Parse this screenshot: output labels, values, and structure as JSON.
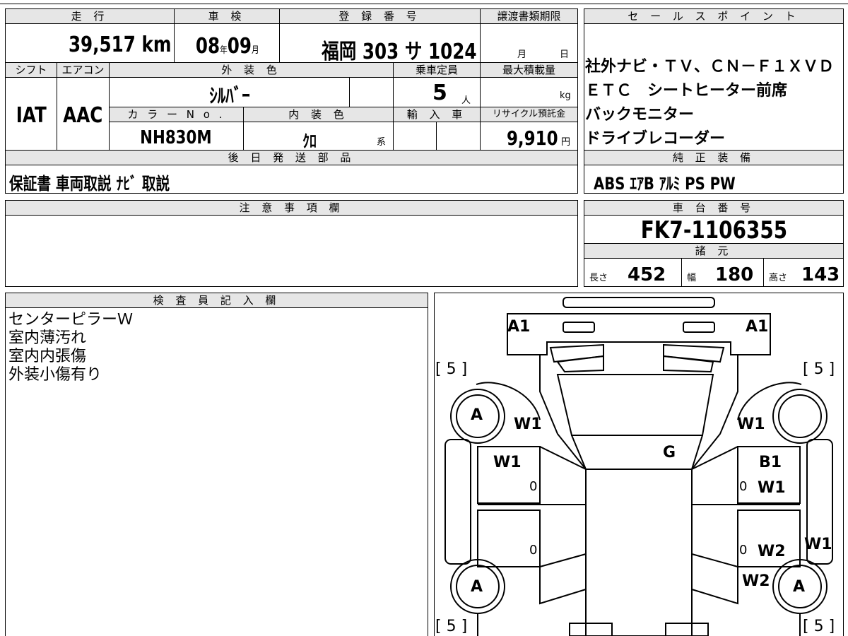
{
  "headers": {
    "mileage": "走 行",
    "inspection": "車 検",
    "registration": "登 録 番 号",
    "transfer_deadline": "譲渡書類期限",
    "sales_points": "セ ー ル ス ポ イ ン ト",
    "shift": "シフト",
    "aircon": "エアコン",
    "exterior_color": "外 装 色",
    "capacity": "乗車定員",
    "max_load": "最大積載量",
    "color_no": "カ ラ ー N o .",
    "interior_color": "内 装 色",
    "import": "輸 入 車",
    "recycle": "リサイクル預託金",
    "later_parts": "後 日 発 送 部 品",
    "genuine_equipment": "純 正 装 備",
    "caution": "注 意 事 項 欄",
    "chassis_no": "車 台 番 号",
    "specs": "諸 元",
    "inspector_notes": "検 査 員 記 入 欄"
  },
  "vehicle": {
    "mileage_value": "39,517",
    "mileage_unit": "km",
    "inspection_year": "08",
    "year_unit": "年",
    "inspection_month": "09",
    "month_unit": "月",
    "registration": "福岡 303 サ 1024",
    "deadline_month": "月",
    "deadline_day": "日",
    "shift": "IAT",
    "aircon": "AAC",
    "exterior_color": "ｼﾙﾊﾞｰ",
    "capacity_value": "5",
    "capacity_unit": "人",
    "max_load_unit": "kg",
    "color_no": "NH830M",
    "interior_color": "ｸﾛ",
    "interior_suffix": "系",
    "recycle_value": "9,910",
    "recycle_unit": "円",
    "later_parts": "保証書 車両取説 ﾅﾋﾞ 取説",
    "chassis_no": "FK7-1106355",
    "length_label": "長さ",
    "length_value": "452",
    "width_label": "幅",
    "width_value": "180",
    "height_label": "高さ",
    "height_value": "143"
  },
  "sales_points": [
    "社外ナビ・ＴＶ、ＣＮ－Ｆ１ＸＶＤ",
    "ＥＴＣ　シートヒーター前席",
    "バックモニター",
    "ドライブレコーダー"
  ],
  "genuine_equipment": "ABS ｴｱB ｱﾙﾐ PS PW",
  "inspector_notes": [
    "センターピラーＷ",
    "室内薄汚れ",
    "室内内張傷",
    "外装小傷有り"
  ],
  "damage_map": {
    "front_left_a": "A1",
    "front_right_a": "A1",
    "tread_fl": "[ 5 ]",
    "tread_fr": "[ 5 ]",
    "tread_rl": "[ 5 ]",
    "tread_rr": "[ 5 ]",
    "wheel_fl": "A",
    "wheel_rl": "A",
    "wheel_rr": "A",
    "fender_fl": "W1",
    "fender_fr": "W1",
    "door_fl": "W1",
    "roof": "G",
    "door_fr_b": "B1",
    "door_fr_w": "W1",
    "door_rr_w2": "W2",
    "quarter_rr_w2": "W2",
    "side_right": "W1",
    "zero_1": "0",
    "zero_2": "0",
    "zero_3": "0",
    "zero_4": "0"
  }
}
